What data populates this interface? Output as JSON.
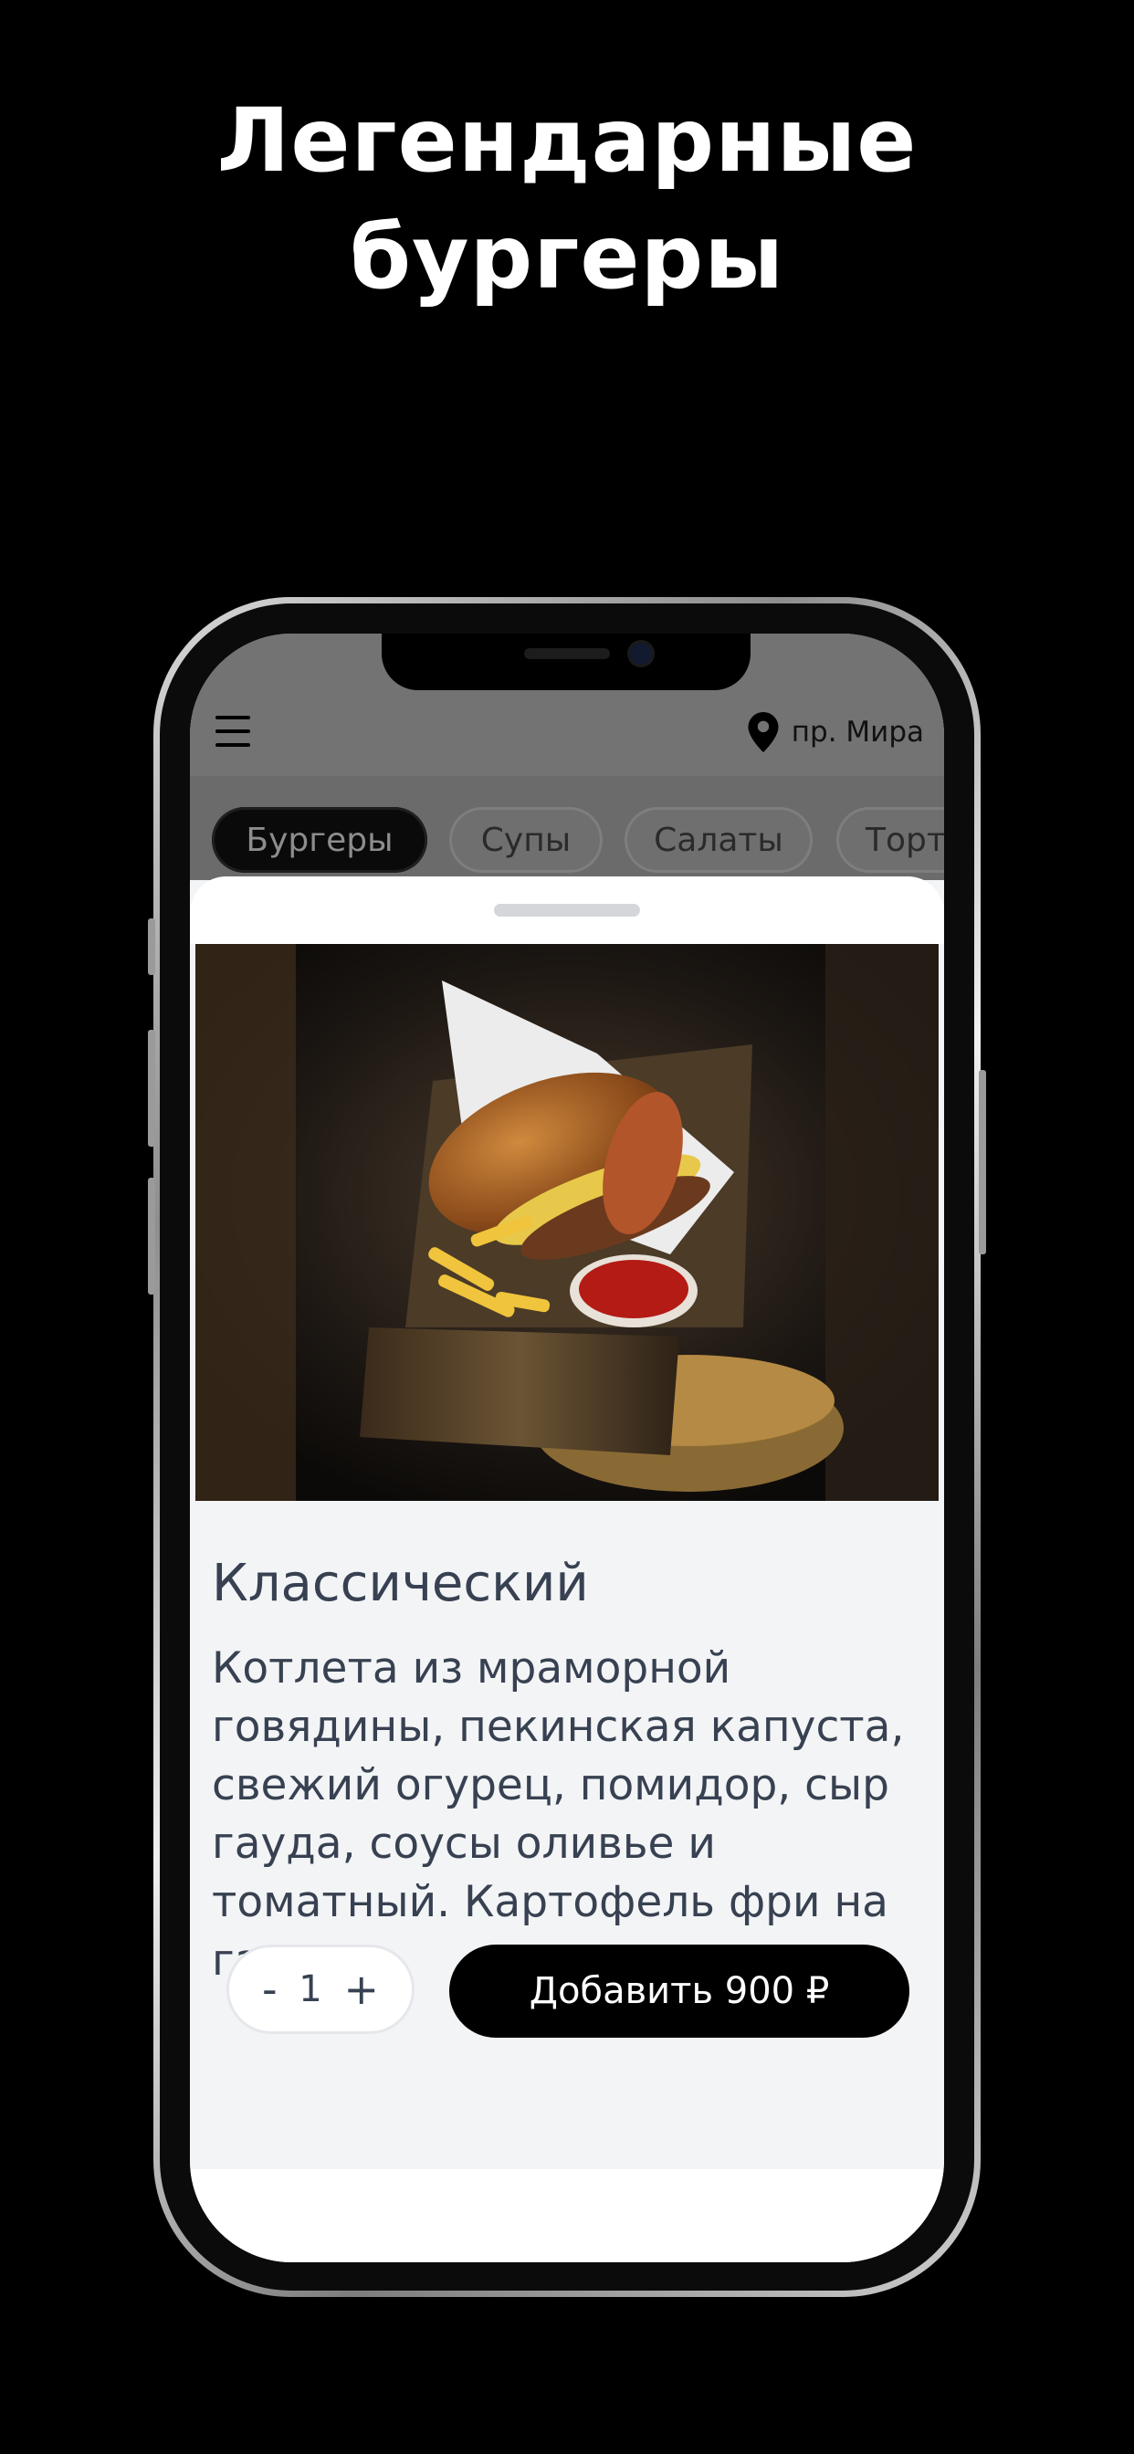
{
  "headline": {
    "line1": "Легендарные",
    "line2": "бургеры"
  },
  "header": {
    "location": "пр. Мира"
  },
  "categories": [
    {
      "label": "Бургеры",
      "active": true
    },
    {
      "label": "Супы",
      "active": false
    },
    {
      "label": "Салаты",
      "active": false
    },
    {
      "label": "Торты",
      "active": false
    }
  ],
  "product": {
    "title": "Классический",
    "description": "Котлета из мраморной говядины, пекинская капуста, свежий огурец, помидор, сыр гауда, соусы оливье и томатный. Картофель фри на гарнир.",
    "image_icon": "burger-photo"
  },
  "order": {
    "minus": "-",
    "quantity": "1",
    "plus": "+",
    "add_label": "Добавить 900 ₽"
  },
  "colors": {
    "background": "#000000",
    "accent": "#000000",
    "sheet": "#f3f4f6",
    "text": "#374151"
  }
}
